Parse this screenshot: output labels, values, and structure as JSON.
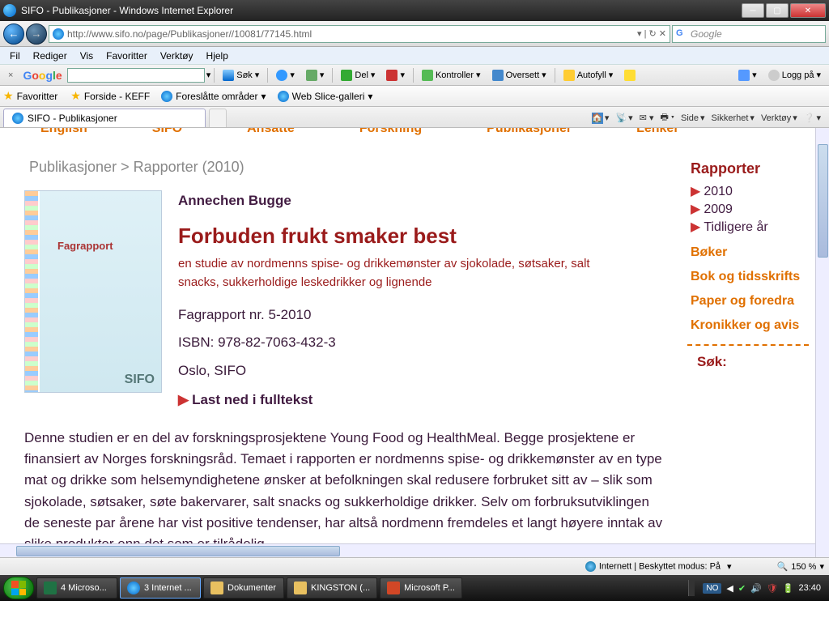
{
  "titlebar": {
    "title": "SIFO - Publikasjoner - Windows Internet Explorer"
  },
  "nav": {
    "url": "http://www.sifo.no/page/Publikasjoner//10081/77145.html",
    "search_placeholder": "Google"
  },
  "menu": {
    "file": "Fil",
    "edit": "Rediger",
    "view": "Vis",
    "favorites": "Favoritter",
    "tools": "Verktøy",
    "help": "Hjelp"
  },
  "gtoolbar": {
    "sok": "Søk",
    "del": "Del",
    "kontroller": "Kontroller",
    "oversett": "Oversett",
    "autofyll": "Autofyll",
    "loggpa": "Logg på"
  },
  "favbar": {
    "favoritter": "Favoritter",
    "forside": "Forside - KEFF",
    "foreslatte": "Foreslåtte områder",
    "webslice": "Web Slice-galleri"
  },
  "tab": {
    "title": "SIFO - Publikasjoner"
  },
  "tabtools": {
    "side": "Side",
    "sikkerhet": "Sikkerhet",
    "verktoy": "Verktøy"
  },
  "topnav": {
    "a": "English",
    "b": "SIFO",
    "c": "Ansatte",
    "d": "Forskning",
    "e": "Publikasjoner",
    "f": "Lenker"
  },
  "breadcrumb": "Publikasjoner > Rapporter (2010)",
  "cover": {
    "label": "Fagrapport",
    "brand": "SIFO"
  },
  "pub": {
    "author": "Annechen Bugge",
    "title": "Forbuden frukt smaker best",
    "subtitle": "en studie av nordmenns spise- og drikkemønster av sjokolade, søtsaker, salt snacks, sukkerholdige leskedrikker og lignende",
    "report": "Fagrapport nr. 5-2010",
    "isbn": "ISBN: 978-82-7063-432-3",
    "place": "Oslo, SIFO",
    "download": "Last ned i fulltekst",
    "body": "Denne studien er en del av forskningsprosjektene Young Food og HealthMeal. Begge prosjektene er finansiert av Norges forskningsråd. Temaet i rapporten er nordmenns spise- og drikkemønster av en type mat og drikke som helsemyndighetene ønsker at befolkningen skal redusere forbruket sitt av – slik som sjokolade, søtsaker, søte bakervarer, salt snacks og sukkerholdige drikker. Selv om forbruksutviklingen de seneste par årene har vist positive tendenser, har altså nordmenn fremdeles et langt høyere inntak av slike produkter enn det som er tilrådelig."
  },
  "sidebar": {
    "rapporter": "Rapporter",
    "y2010": "2010",
    "y2009": "2009",
    "tidligere": "Tidligere år",
    "boker": "Bøker",
    "boktids": "Bok og tidsskrifts",
    "paper": "Paper og foredra",
    "kronikker": "Kronikker og avis",
    "sok": "Søk:"
  },
  "status": {
    "mode": "Internett | Beskyttet modus: På",
    "zoom": "150 %"
  },
  "taskbar": {
    "b1": "4 Microso...",
    "b2": "3 Internet ...",
    "b3": "Dokumenter",
    "b4": "KINGSTON (...",
    "b5": "Microsoft P...",
    "lang": "NO",
    "time": "23:40"
  }
}
